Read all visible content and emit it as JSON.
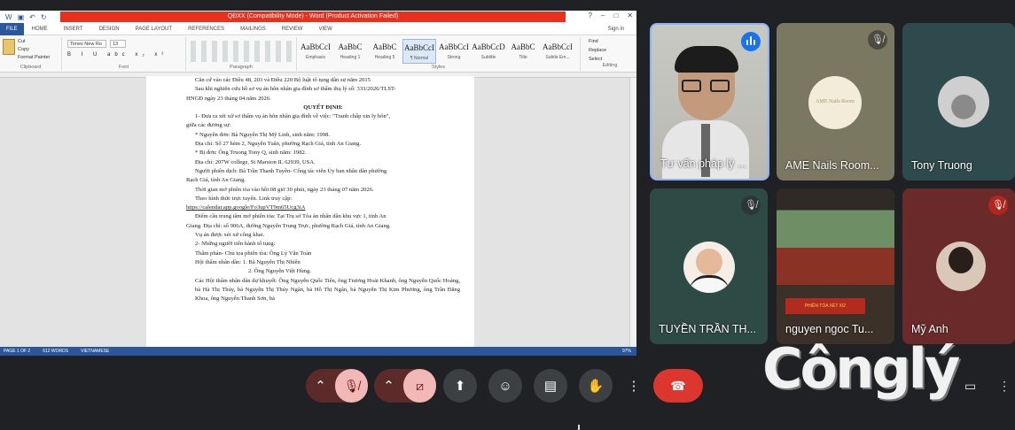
{
  "word": {
    "title": "QĐXX (Compatibility Mode) - Word (Product Activation Failed)",
    "tabs": [
      "FILE",
      "HOME",
      "INSERT",
      "DESIGN",
      "PAGE LAYOUT",
      "REFERENCES",
      "MAILINGS",
      "REVIEW",
      "VIEW"
    ],
    "signin": "Sign in",
    "clipboard": {
      "paste": "Paste",
      "cut": "Cut",
      "copy": "Copy",
      "format_painter": "Format Painter",
      "label": "Clipboard"
    },
    "font": {
      "name": "Times New Ro",
      "size": "13",
      "label": "Font",
      "buttons": "B I U abc x₂ x²"
    },
    "paragraph_label": "Paragraph",
    "styles": [
      {
        "sample": "AaBbCcI",
        "name": "Emphasis"
      },
      {
        "sample": "AaBbC",
        "name": "Heading 1"
      },
      {
        "sample": "AaBbC",
        "name": "Heading 5"
      },
      {
        "sample": "AaBbCcI",
        "name": "¶ Normal"
      },
      {
        "sample": "AaBbCcI",
        "name": "Strong"
      },
      {
        "sample": "AaBbCcD",
        "name": "Subtitle"
      },
      {
        "sample": "AaBbC",
        "name": "Title"
      },
      {
        "sample": "AaBbCcI",
        "name": "Subtle Em..."
      }
    ],
    "styles_label": "Styles",
    "editing": {
      "find": "Find",
      "replace": "Replace",
      "select": "Select",
      "label": "Editing"
    },
    "status": {
      "page": "PAGE 1 OF 2",
      "words": "612 WORDS",
      "lang": "VIETNAMESE",
      "zoom": "97%"
    },
    "doc": {
      "l1": "Căn cứ vào các Điều 48, 203 và Điều 220 Bộ luật tố tụng dân sự năm 2015",
      "l2": "Sau khi nghiên cứu hồ sơ vụ án hôn nhân gia đình sơ thẩm thụ lý số: 333/2026/TLST-",
      "l3": "HNGĐ ngày 23 tháng 04 năm 2026.",
      "heading": "QUYẾT ĐỊNH:",
      "p1": "1- Đưa ra xét xử sơ thẩm vụ án hôn nhân gia đình về việc: \"Tranh chấp xin ly hôn\",",
      "p1b": "giữa các đương sự:",
      "plaintiff": "* Nguyên đơn: Bà Nguyễn Thị Mỹ Linh, sinh năm: 1998.",
      "plaintiff_addr": "Địa chỉ: Số 27 hẻm 2, Nguyễn Tuân, phường Rạch Giá, tỉnh An Giang.",
      "defendant": "* Bị đơn: Ông Truong Tony Q, sinh năm: 1982.",
      "defendant_addr": "Địa chỉ: 207W college, St Marston IL 62939, USA.",
      "interpreter": "Người phiên dịch: Bà Trần Thanh Tuyền- Công tác viên Ủy ban nhân dân phường",
      "interpreter_b": "Rạch Giá, tỉnh An Giang.",
      "time": "Thời gian mở phiên tòa vào hồi 08 giờ 30 phút, ngày 23 tháng 07 năm 2026.",
      "online": "Theo hình thức trực tuyến. Link truy cập:",
      "link": "https://calendar.app.google/Fo3upVT9m65Ucg3iA",
      "venue": "Điểm cầu trung tâm mở phiên tòa: Tại Trụ sở Tòa án nhân dân khu vực 1, tỉnh An",
      "venue_b": "Giang. Địa chỉ: số 906A, đường Nguyễn Trung Trực, phường Rạch Giá, tỉnh An Giang.",
      "public": "Vụ án được xét xử công khai.",
      "people": "2- Những người tiến hành tố tụng:",
      "judge": "Thẩm phán- Chủ tọa phiên tòa: Ông Lý Văn Toàn",
      "juror1": "Hội thẩm nhân dân: 1. Bà Nguyễn Thị Nhiên",
      "juror2": "2. Ông Nguyễn Việt Hùng.",
      "others": "Các Hội thẩm nhân dân dự khuyết: Ông Nguyễn Quốc Tiến, ông Trương Hoài Khanh, ông Nguyễn Quốc Hoàng, bà Hà Thị Thủy, bà Nguyễn Thị Thúy Ngân, bà Hồ Thị Ngân, bà Nguyễn Thị Kim Phương, ông Trần Đăng Khoa, ông Nguyễn Thanh Sơn, bà"
    }
  },
  "participants": [
    {
      "name": "Tư vấn pháp lý ...",
      "muted": false,
      "speaking": true
    },
    {
      "name": "AME Nails Room...",
      "muted": true
    },
    {
      "name": "Tony Truong",
      "muted": false
    },
    {
      "name": "TUYỀN TRẦN TH...",
      "muted": true
    },
    {
      "name": "nguyen ngoc Tu...",
      "muted": false
    },
    {
      "name": "Mỹ Anh",
      "muted": true
    }
  ],
  "room_banner": "PHIÊN TÒA XÉT XỬ",
  "logo_text": "AME Nails Room",
  "watermark": "Cônglý",
  "controls": {
    "mic_icon": "mic-off-icon",
    "cam_icon": "camera-off-icon",
    "present_icon": "present-icon",
    "emoji_icon": "emoji-icon",
    "captions_icon": "captions-icon",
    "hand_icon": "raise-hand-icon",
    "more_icon": "more-vert-icon",
    "end_icon": "end-call-icon",
    "chat_icon": "chat-icon",
    "apps_icon": "apps-icon"
  },
  "colors": {
    "word_blue": "#2b579a",
    "title_red": "#e8301c",
    "end_call": "#dc362e",
    "speaking_border": "#8ab4f8"
  }
}
